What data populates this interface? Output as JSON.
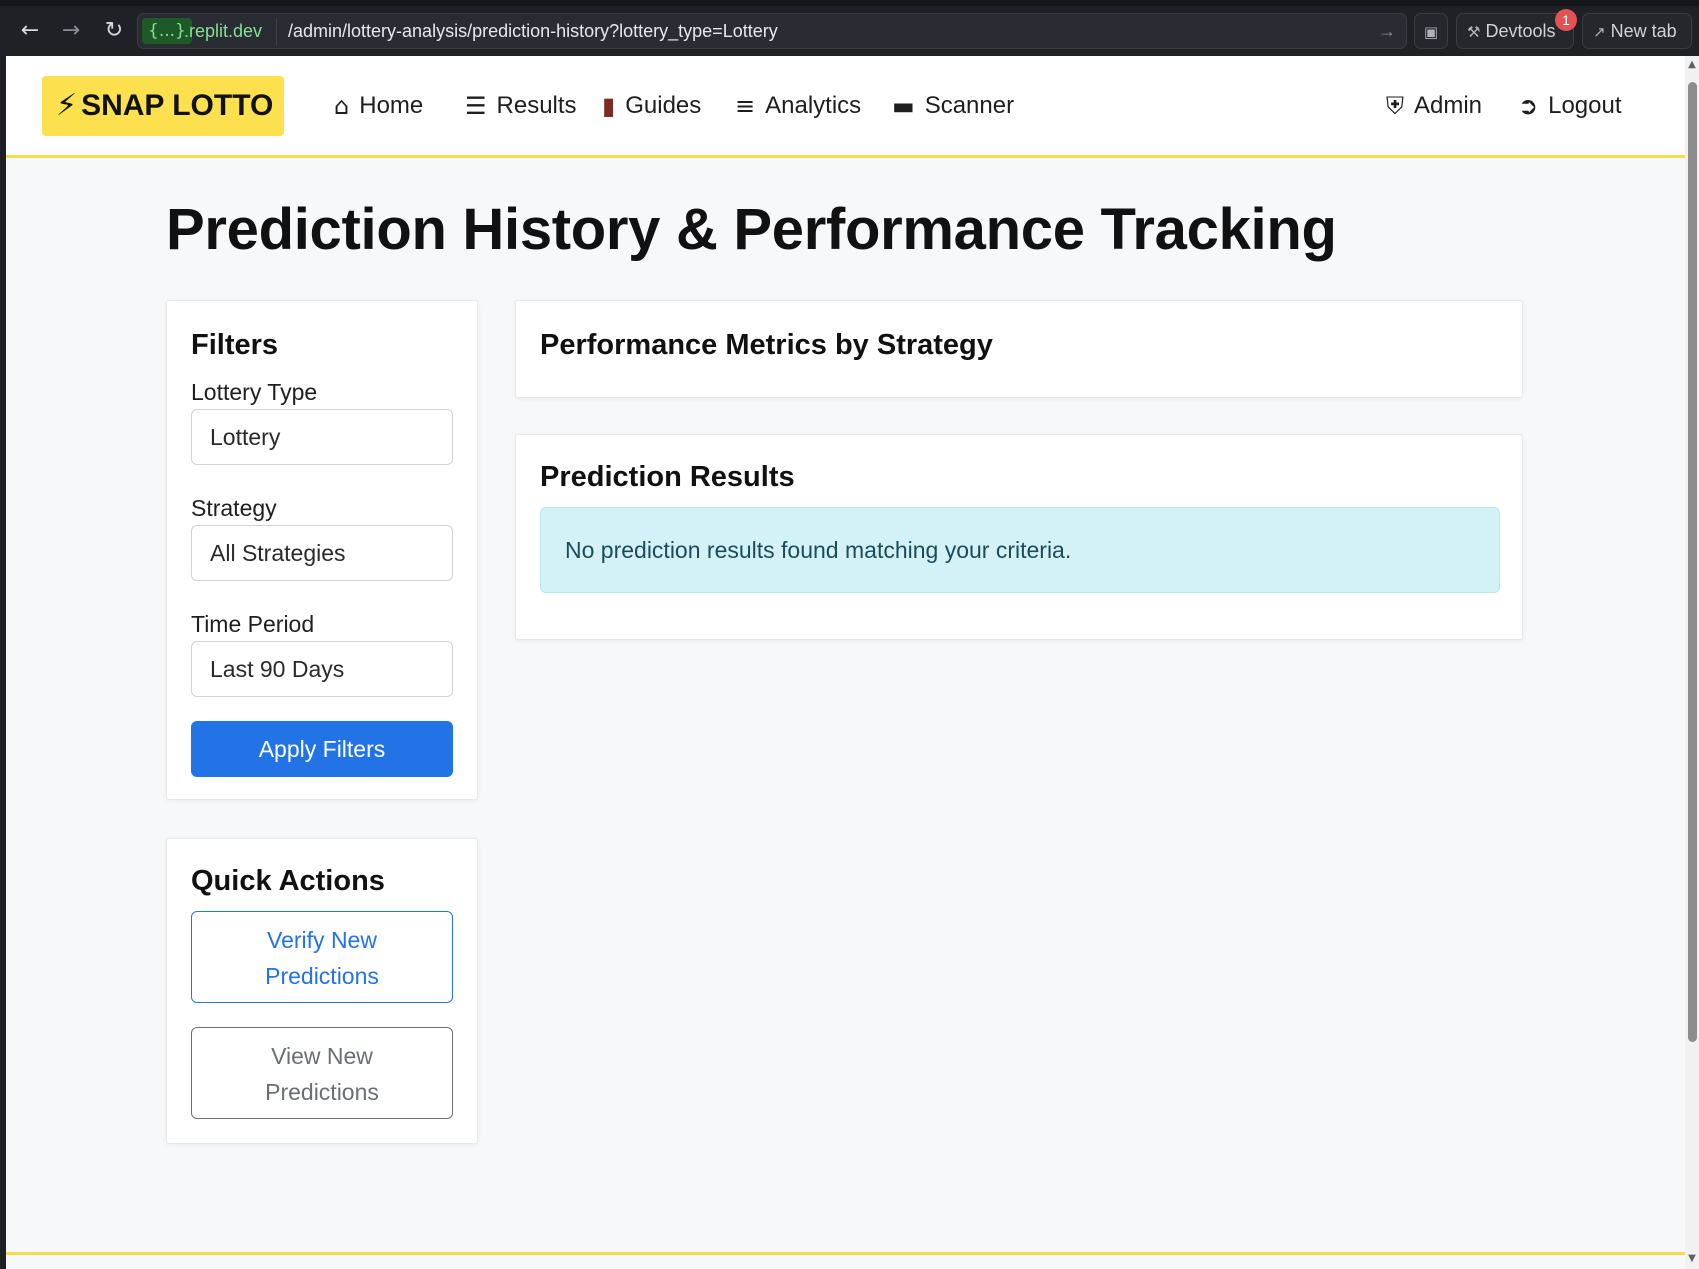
{
  "browser": {
    "url_badge": "{...}",
    "url_domain": ".replit.dev",
    "url_path": "/admin/lottery-analysis/prediction-history?lottery_type=Lottery",
    "devtools_label": "Devtools",
    "devtools_count": "1",
    "new_tab_label": "New tab"
  },
  "navbar": {
    "brand": "SNAP LOTTO",
    "links": [
      {
        "label": "Home",
        "icon": "home-icon"
      },
      {
        "label": "Results",
        "icon": "list-icon"
      },
      {
        "label": "Guides",
        "icon": "book-icon"
      },
      {
        "label": "Analytics",
        "icon": "chart-icon"
      },
      {
        "label": "Scanner",
        "icon": "ticket-icon"
      }
    ],
    "admin_label": "Admin",
    "logout_label": "Logout"
  },
  "page": {
    "title": "Prediction History & Performance Tracking"
  },
  "filters": {
    "title": "Filters",
    "lottery_type_label": "Lottery Type",
    "lottery_type_value": "Lottery",
    "strategy_label": "Strategy",
    "strategy_value": "All Strategies",
    "time_period_label": "Time Period",
    "time_period_value": "Last 90 Days",
    "apply_label": "Apply Filters"
  },
  "quick_actions": {
    "title": "Quick Actions",
    "verify_line1": "Verify New",
    "verify_line2": "Predictions",
    "view_line1": "View New",
    "view_line2": "Predictions"
  },
  "metrics": {
    "title": "Performance Metrics by Strategy"
  },
  "results": {
    "title": "Prediction Results",
    "empty_message": "No prediction results found matching your criteria."
  },
  "colors": {
    "brand_yellow": "#fce04e",
    "primary_blue": "#2274e6",
    "alert_bg": "#d3f2f8"
  }
}
